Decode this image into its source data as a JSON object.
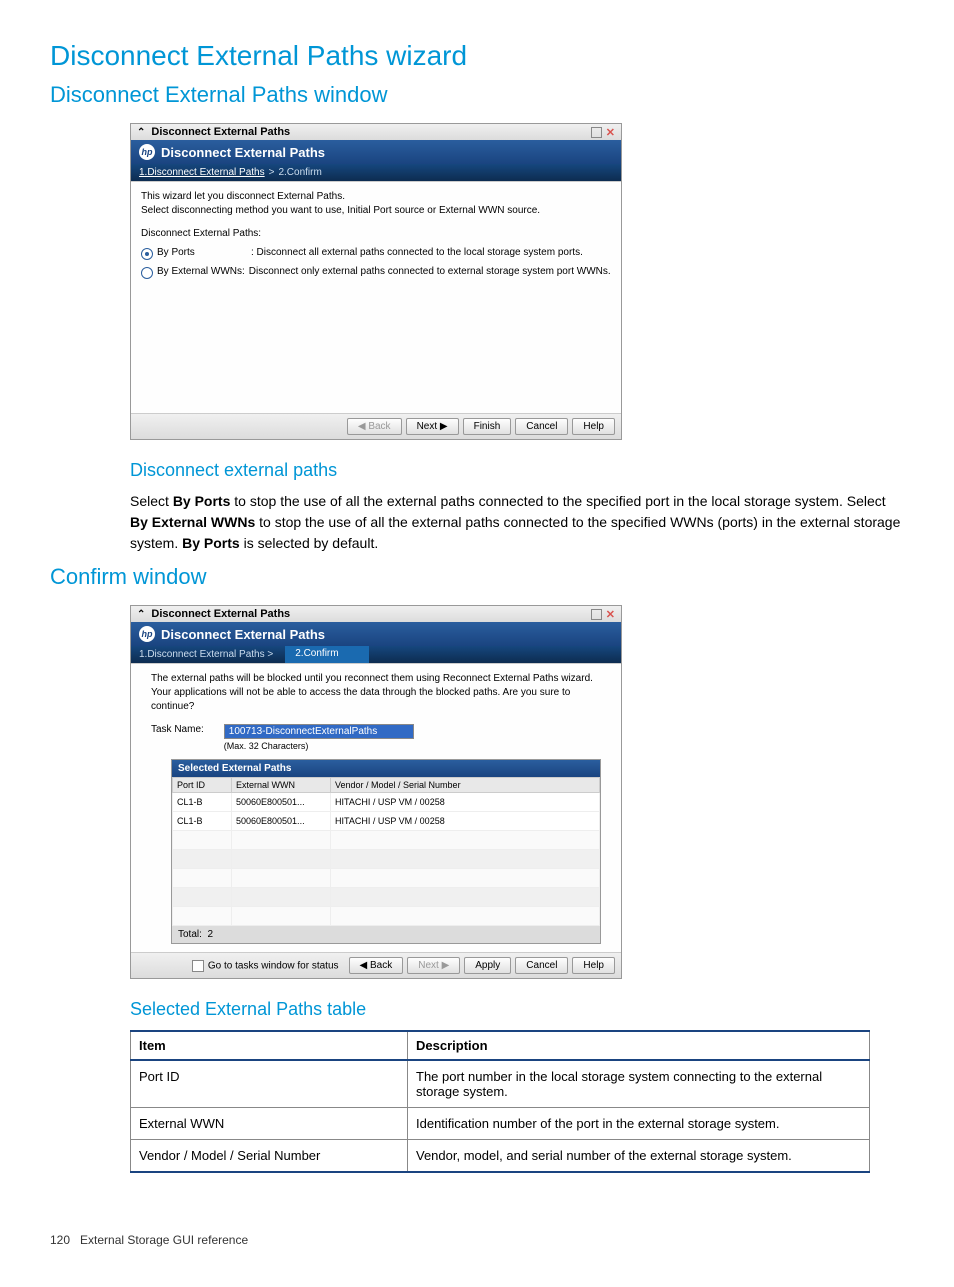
{
  "page": {
    "title": "Disconnect External Paths wizard",
    "section1_title": "Disconnect External Paths window",
    "section2_title": "Confirm window",
    "footer_pagenum": "120",
    "footer_text": "External Storage GUI reference"
  },
  "screenshot1": {
    "titlebar": "Disconnect External Paths",
    "header": "Disconnect External Paths",
    "breadcrumb": {
      "step1": "1.Disconnect External Paths",
      "sep": ">",
      "step2": "2.Confirm"
    },
    "desc_line1": "This wizard let you disconnect External Paths.",
    "desc_line2": "Select disconnecting method you want to use, Initial Port source or External WWN source.",
    "paths_label": "Disconnect External Paths:",
    "radio1_label": "By Ports",
    "radio1_desc": ": Disconnect all external paths connected to the local storage system ports.",
    "radio2_label": "By External WWNs:",
    "radio2_desc": "Disconnect only external paths connected to external storage system port WWNs.",
    "btn_back": "◀ Back",
    "btn_next": "Next ▶",
    "btn_finish": "Finish",
    "btn_cancel": "Cancel",
    "btn_help": "Help"
  },
  "disconnect_section": {
    "title": "Disconnect external paths",
    "para_pre": "Select ",
    "bold1": "By Ports",
    "para_mid1": " to stop the use of all the external paths connected to the specified port in the local storage system. Select ",
    "bold2": "By External WWNs",
    "para_mid2": " to stop the use of all the external paths connected to the specified WWNs (ports) in the external storage system. ",
    "bold3": "By Ports",
    "para_end": " is selected by default."
  },
  "screenshot2": {
    "titlebar": "Disconnect External Paths",
    "header": "Disconnect External Paths",
    "breadcrumb_step1": "1.Disconnect External Paths  >",
    "breadcrumb_step2": "2.Confirm",
    "desc_line1": "The external paths will be blocked until you reconnect them using Reconnect External Paths wizard.",
    "desc_line2": "Your applications will not be able to access the data through the blocked paths. Are you sure to continue?",
    "task_label": "Task Name:",
    "task_value": "100713-DisconnectExternalPaths",
    "task_hint": "(Max. 32 Characters)",
    "table_title": "Selected External Paths",
    "columns": {
      "c1": "Port ID",
      "c2": "External WWN",
      "c3": "Vendor / Model / Serial Number"
    },
    "rows": [
      {
        "c1": "CL1-B",
        "c2": "50060E800501...",
        "c3": "HITACHI / USP VM / 00258"
      },
      {
        "c1": "CL1-B",
        "c2": "50060E800501...",
        "c3": "HITACHI / USP VM / 00258"
      }
    ],
    "total_label": "Total:",
    "total_value": "2",
    "checkbox_label": "Go to tasks window for status",
    "btn_back": "◀ Back",
    "btn_next": "Next ▶",
    "btn_apply": "Apply",
    "btn_cancel": "Cancel",
    "btn_help": "Help"
  },
  "selected_table_section": {
    "title": "Selected External Paths table",
    "header_item": "Item",
    "header_desc": "Description",
    "rows": [
      {
        "item": "Port ID",
        "desc": "The port number in the local storage system connecting to the external storage system."
      },
      {
        "item": "External WWN",
        "desc": "Identification number of the port in the external storage system."
      },
      {
        "item": "Vendor / Model / Serial Number",
        "desc": "Vendor, model, and serial number of the external storage system."
      }
    ]
  }
}
